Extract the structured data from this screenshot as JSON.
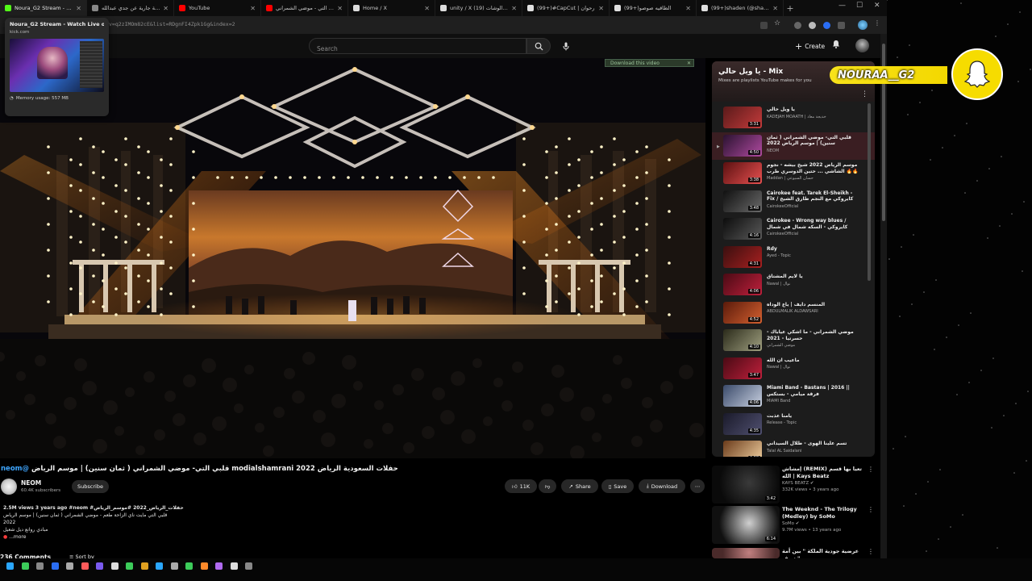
{
  "browser": {
    "tabs": [
      {
        "label": "Noura_G2 Stream - Watch",
        "color": "#53fc18",
        "active": true
      },
      {
        "label": "صدقة جارية عن جدي عبدالله",
        "color": "#888888",
        "active": false
      },
      {
        "label": "YouTube",
        "color": "#ff0000",
        "active": false
      },
      {
        "label": "قلبي التي - موضي الشمراني",
        "color": "#ff0000",
        "active": false
      },
      {
        "label": "Home / X",
        "color": "#dddddd",
        "active": false
      },
      {
        "label": "unity / X قطاع الوشات (19)",
        "color": "#dddddd",
        "active": false
      },
      {
        "label": "(99+)#CapCut | رحوان",
        "color": "#e0e0e0",
        "active": false
      },
      {
        "label": "(99+)الطاقيه صوصو",
        "color": "#e0e0e0",
        "active": false
      },
      {
        "label": "(99+)shaden (@shaden_S",
        "color": "#e0e0e0",
        "active": false
      }
    ],
    "new_tab": "+",
    "url": "v=q2zIMOm82cE&list=RDgnFI4Zpk1Gg&index=2",
    "hover_card": {
      "title": "Noura_G2 Stream - Watch Live on Kick",
      "domain": "kick.com",
      "memory": "Memory usage: 557 MB"
    }
  },
  "youtube": {
    "search_placeholder": "Search",
    "create_label": "Create",
    "download_banner": "Download this video",
    "video": {
      "title_prefix": "حفلات السعودية الرياض modialshamrani 2022",
      "title_rest": "قلبي التي- موضي الشمراني ( ثمان سنين) | موسم الرياض",
      "title_link": "@neom",
      "channel": "NEOM",
      "subscribers": "60.4K subscribers",
      "subscribe_label": "Subscribe",
      "likes": "11K",
      "share_label": "Share",
      "save_label": "Save",
      "download_label": "Download",
      "description_stats": "2.5M views 3 years ago #neom #حفلات_الرياض_2022 #موسم_الرياض",
      "description_line1": "قلبي التي مايت ناي الزاحة طعم - موضي الشمراني ( ثمان سنين) | موسم الرياض",
      "description_line2": "2022",
      "description_line3": "مبادي روانع ديل شعيل",
      "description_more": "...more",
      "comments_label": "236 Comments",
      "sort_label": "Sort by"
    },
    "mix": {
      "title": "Mix - يا ويل حالي",
      "subtitle": "Mixes are playlists YouTube makes for you",
      "items": [
        {
          "title": "يا ويل حالي",
          "channel": "KADEJAH MOAATH | خديجة معاذ",
          "duration": "3:31",
          "colors": [
            "#5a1a1a",
            "#c43b3b"
          ]
        },
        {
          "title": "قلبي التي- موضي الشمراني ( ثمان سنين) | موسم الرياض 2022",
          "channel": "NEOM",
          "duration": "4:50",
          "colors": [
            "#2a1230",
            "#b04aa0"
          ],
          "current": true
        },
        {
          "title": "موسم الرياض 2022 شيخ بيشه - نجوم 🔥🔥 الشاشي ... حتين الدوسري طرب",
          "channel": "Maddan | حسان السيوعي",
          "duration": "3:38",
          "colors": [
            "#5a1010",
            "#e85050"
          ]
        },
        {
          "title": "Cairokee feat. Tarek El-Sheikh - Fix / كايروكي مع النجم طارق الشيخ",
          "channel": "CairokeeOfficial",
          "duration": "3:48",
          "colors": [
            "#101010",
            "#6a6a6a"
          ]
        },
        {
          "title": "Cairokee - Wrong way blues / كايروكي - السكه شمال في شمال",
          "channel": "CairokeeOfficial",
          "duration": "4:16",
          "colors": [
            "#0c0c0c",
            "#5a5a5a"
          ]
        },
        {
          "title": "Rdy",
          "channel": "Ayed - Topic",
          "duration": "4:31",
          "colors": [
            "#3a0f0f",
            "#a82020"
          ]
        },
        {
          "title": "يا لايم المشتاق",
          "channel": "Nawal | نوال",
          "duration": "4:06",
          "colors": [
            "#4a0a14",
            "#c0203c"
          ]
        },
        {
          "title": "المنسم دايف | ياع الوداه",
          "channel": "ABDULMALIK ALDAWSARI",
          "duration": "4:52",
          "colors": [
            "#5a1a0a",
            "#d46030"
          ]
        },
        {
          "title": "موضي الشمراني - ما اشكي عياباك - حسرتيا - 2021",
          "channel": "موضي الشمراني",
          "duration": "4:10",
          "colors": [
            "#2a2a1a",
            "#a0a080"
          ]
        },
        {
          "title": "ماعيب ان الله",
          "channel": "Nawal | نوال",
          "duration": "3:47",
          "colors": [
            "#4a0a14",
            "#c0203c"
          ]
        },
        {
          "title": "Miami Band - Bastans | 2016 || فرقة ميامي - بستكس",
          "channel": "MIAMI Band",
          "duration": "4:06",
          "colors": [
            "#3a4a6a",
            "#c8d0e0"
          ]
        },
        {
          "title": "يامنا عذبت",
          "channel": "Release - Topic",
          "duration": "4:35",
          "colors": [
            "#1a1a2a",
            "#505070"
          ]
        },
        {
          "title": "تسم علينا الهوى - طلال السيداني",
          "channel": "Talal AL Saidalani",
          "duration": "4:08",
          "colors": [
            "#6a3a1a",
            "#f0d0a0"
          ]
        }
      ]
    },
    "recommendations": [
      {
        "title": "إمشاش (REMIX) تعيا بها قسم الله | Kays Beatz",
        "channel": "KAYS BEATZ ✔",
        "meta": "332K views • 3 years ago",
        "duration": "3:42",
        "colors": [
          "#0a0a0a",
          "#3a3a3a"
        ]
      },
      {
        "title": "The Weeknd - The Trilogy (Medley) by SoMo",
        "channel": "SoMo ✔",
        "meta": "9.7M views • 13 years ago",
        "duration": "6:14",
        "colors": [
          "#101010",
          "#d0d0d0"
        ]
      },
      {
        "title": "عرضية جودية الملكة \" بين أمة سيف \"",
        "channel": "",
        "meta": "",
        "duration": "",
        "colors": [
          "#4a2a2a",
          "#c08080"
        ]
      }
    ]
  },
  "overlay": {
    "snap_username": "NOURAA__G2"
  },
  "colors": {
    "accent": "#3ea6ff",
    "snap_yellow": "#f6dc00",
    "kick_green": "#53fc18",
    "youtube_red": "#ff0000"
  }
}
